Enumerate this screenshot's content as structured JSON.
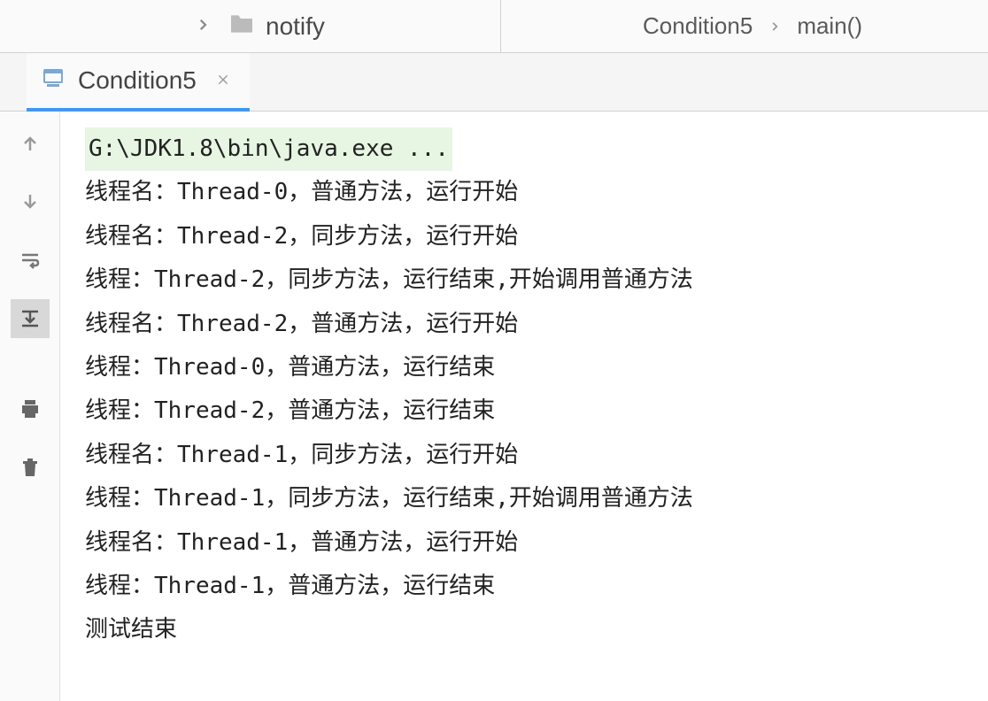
{
  "topBar": {
    "folderName": "notify"
  },
  "breadcrumb": {
    "items": [
      "Condition5",
      "main()"
    ]
  },
  "tab": {
    "label": "Condition5"
  },
  "console": {
    "execLine": "G:\\JDK1.8\\bin\\java.exe ...",
    "lines": [
      "线程名：Thread-0，普通方法，运行开始",
      "线程名：Thread-2，同步方法，运行开始",
      "线程：Thread-2，同步方法，运行结束,开始调用普通方法",
      "线程名：Thread-2，普通方法，运行开始",
      "线程：Thread-0，普通方法，运行结束",
      "线程：Thread-2，普通方法，运行结束",
      "线程名：Thread-1，同步方法，运行开始",
      "线程：Thread-1，同步方法，运行结束,开始调用普通方法",
      "线程名：Thread-1，普通方法，运行开始",
      "线程：Thread-1，普通方法，运行结束",
      "测试结束"
    ]
  }
}
